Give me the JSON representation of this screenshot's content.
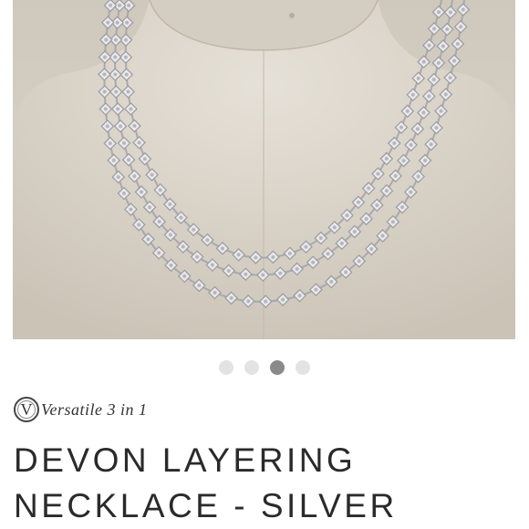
{
  "product": {
    "image_alt": "",
    "badge_icon": "V",
    "badge_text": "Versatile 3 in 1",
    "title_line1": "DEVON LAYERING",
    "title_line2": "NECKLACE - SILVER"
  },
  "carousel": {
    "count": 4,
    "active_index": 2
  },
  "colors": {
    "background": "#ffffff",
    "dot_inactive": "#e3e3e3",
    "dot_active": "#8a8a8a",
    "title": "#2a2a2a"
  }
}
